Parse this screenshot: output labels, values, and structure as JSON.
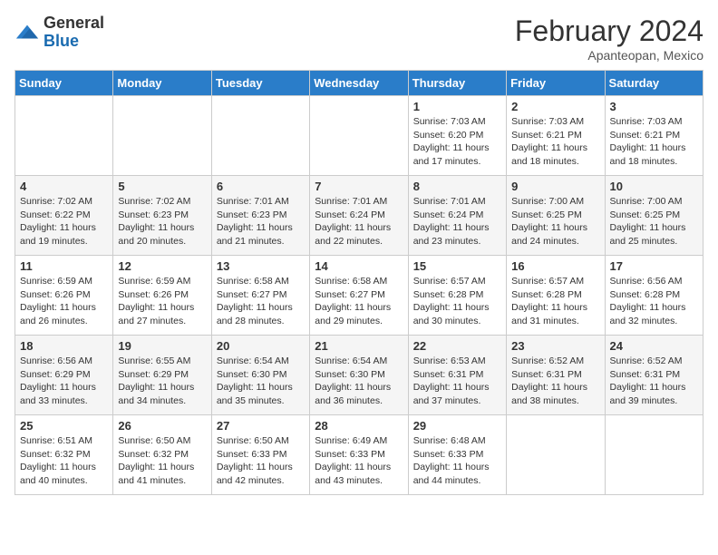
{
  "logo": {
    "general": "General",
    "blue": "Blue"
  },
  "title": "February 2024",
  "subtitle": "Apanteopan, Mexico",
  "days_of_week": [
    "Sunday",
    "Monday",
    "Tuesday",
    "Wednesday",
    "Thursday",
    "Friday",
    "Saturday"
  ],
  "weeks": [
    [
      {
        "day": "",
        "info": ""
      },
      {
        "day": "",
        "info": ""
      },
      {
        "day": "",
        "info": ""
      },
      {
        "day": "",
        "info": ""
      },
      {
        "day": "1",
        "info": "Sunrise: 7:03 AM\nSunset: 6:20 PM\nDaylight: 11 hours and 17 minutes."
      },
      {
        "day": "2",
        "info": "Sunrise: 7:03 AM\nSunset: 6:21 PM\nDaylight: 11 hours and 18 minutes."
      },
      {
        "day": "3",
        "info": "Sunrise: 7:03 AM\nSunset: 6:21 PM\nDaylight: 11 hours and 18 minutes."
      }
    ],
    [
      {
        "day": "4",
        "info": "Sunrise: 7:02 AM\nSunset: 6:22 PM\nDaylight: 11 hours and 19 minutes."
      },
      {
        "day": "5",
        "info": "Sunrise: 7:02 AM\nSunset: 6:23 PM\nDaylight: 11 hours and 20 minutes."
      },
      {
        "day": "6",
        "info": "Sunrise: 7:01 AM\nSunset: 6:23 PM\nDaylight: 11 hours and 21 minutes."
      },
      {
        "day": "7",
        "info": "Sunrise: 7:01 AM\nSunset: 6:24 PM\nDaylight: 11 hours and 22 minutes."
      },
      {
        "day": "8",
        "info": "Sunrise: 7:01 AM\nSunset: 6:24 PM\nDaylight: 11 hours and 23 minutes."
      },
      {
        "day": "9",
        "info": "Sunrise: 7:00 AM\nSunset: 6:25 PM\nDaylight: 11 hours and 24 minutes."
      },
      {
        "day": "10",
        "info": "Sunrise: 7:00 AM\nSunset: 6:25 PM\nDaylight: 11 hours and 25 minutes."
      }
    ],
    [
      {
        "day": "11",
        "info": "Sunrise: 6:59 AM\nSunset: 6:26 PM\nDaylight: 11 hours and 26 minutes."
      },
      {
        "day": "12",
        "info": "Sunrise: 6:59 AM\nSunset: 6:26 PM\nDaylight: 11 hours and 27 minutes."
      },
      {
        "day": "13",
        "info": "Sunrise: 6:58 AM\nSunset: 6:27 PM\nDaylight: 11 hours and 28 minutes."
      },
      {
        "day": "14",
        "info": "Sunrise: 6:58 AM\nSunset: 6:27 PM\nDaylight: 11 hours and 29 minutes."
      },
      {
        "day": "15",
        "info": "Sunrise: 6:57 AM\nSunset: 6:28 PM\nDaylight: 11 hours and 30 minutes."
      },
      {
        "day": "16",
        "info": "Sunrise: 6:57 AM\nSunset: 6:28 PM\nDaylight: 11 hours and 31 minutes."
      },
      {
        "day": "17",
        "info": "Sunrise: 6:56 AM\nSunset: 6:28 PM\nDaylight: 11 hours and 32 minutes."
      }
    ],
    [
      {
        "day": "18",
        "info": "Sunrise: 6:56 AM\nSunset: 6:29 PM\nDaylight: 11 hours and 33 minutes."
      },
      {
        "day": "19",
        "info": "Sunrise: 6:55 AM\nSunset: 6:29 PM\nDaylight: 11 hours and 34 minutes."
      },
      {
        "day": "20",
        "info": "Sunrise: 6:54 AM\nSunset: 6:30 PM\nDaylight: 11 hours and 35 minutes."
      },
      {
        "day": "21",
        "info": "Sunrise: 6:54 AM\nSunset: 6:30 PM\nDaylight: 11 hours and 36 minutes."
      },
      {
        "day": "22",
        "info": "Sunrise: 6:53 AM\nSunset: 6:31 PM\nDaylight: 11 hours and 37 minutes."
      },
      {
        "day": "23",
        "info": "Sunrise: 6:52 AM\nSunset: 6:31 PM\nDaylight: 11 hours and 38 minutes."
      },
      {
        "day": "24",
        "info": "Sunrise: 6:52 AM\nSunset: 6:31 PM\nDaylight: 11 hours and 39 minutes."
      }
    ],
    [
      {
        "day": "25",
        "info": "Sunrise: 6:51 AM\nSunset: 6:32 PM\nDaylight: 11 hours and 40 minutes."
      },
      {
        "day": "26",
        "info": "Sunrise: 6:50 AM\nSunset: 6:32 PM\nDaylight: 11 hours and 41 minutes."
      },
      {
        "day": "27",
        "info": "Sunrise: 6:50 AM\nSunset: 6:33 PM\nDaylight: 11 hours and 42 minutes."
      },
      {
        "day": "28",
        "info": "Sunrise: 6:49 AM\nSunset: 6:33 PM\nDaylight: 11 hours and 43 minutes."
      },
      {
        "day": "29",
        "info": "Sunrise: 6:48 AM\nSunset: 6:33 PM\nDaylight: 11 hours and 44 minutes."
      },
      {
        "day": "",
        "info": ""
      },
      {
        "day": "",
        "info": ""
      }
    ]
  ]
}
